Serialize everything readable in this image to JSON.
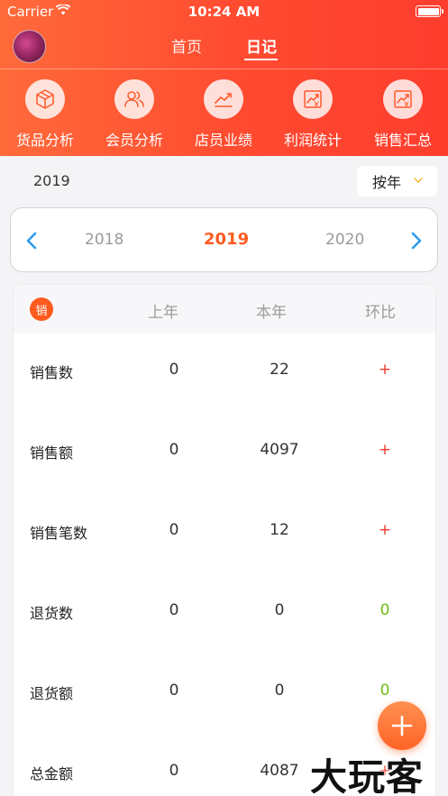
{
  "status": {
    "carrier": "Carrier",
    "time": "10:24 AM"
  },
  "nav": {
    "tab_home": "首页",
    "tab_diary": "日记"
  },
  "quick_actions": [
    {
      "label": "货品分析",
      "icon": "box-icon"
    },
    {
      "label": "会员分析",
      "icon": "users-icon"
    },
    {
      "label": "店员业绩",
      "icon": "trend-icon"
    },
    {
      "label": "利润统计",
      "icon": "profit-chart-icon"
    },
    {
      "label": "销售汇总",
      "icon": "sales-chart-icon"
    }
  ],
  "filter": {
    "year": "2019",
    "mode": "按年"
  },
  "year_picker": {
    "prev": "2018",
    "current": "2019",
    "next": "2020"
  },
  "table": {
    "badge": "销",
    "headers": {
      "last_year": "上年",
      "this_year": "本年",
      "ratio": "环比"
    },
    "rows": [
      {
        "name": "销售数",
        "last": "0",
        "this": "22",
        "ratio": "+"
      },
      {
        "name": "销售额",
        "last": "0",
        "this": "4097",
        "ratio": "+"
      },
      {
        "name": "销售笔数",
        "last": "0",
        "this": "12",
        "ratio": "+"
      },
      {
        "name": "退货数",
        "last": "0",
        "this": "0",
        "ratio": "0"
      },
      {
        "name": "退货额",
        "last": "0",
        "this": "0",
        "ratio": "0"
      },
      {
        "name": "总金额",
        "last": "0",
        "this": "4087",
        "ratio": "+"
      }
    ]
  },
  "watermark": "大玩客",
  "colors": {
    "header_start": "#ff6a3a",
    "header_end": "#fe3d2d",
    "accent": "#fe5b20",
    "positive": "#f03a2a",
    "zero": "#6cc019",
    "blue_arrow": "#2e9cf0"
  }
}
